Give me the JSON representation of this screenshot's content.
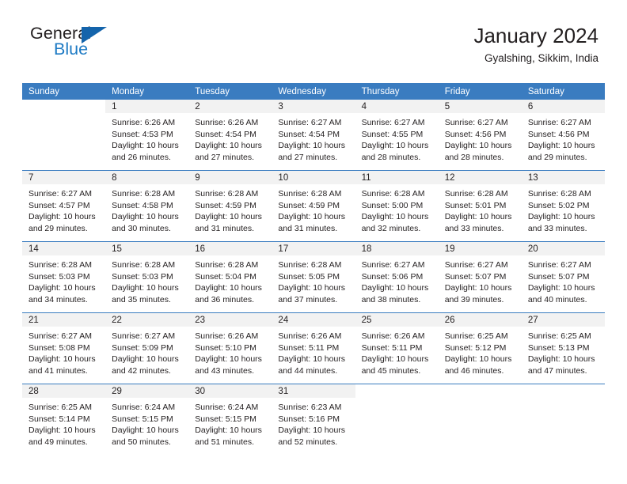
{
  "brand": {
    "name_part1": "General",
    "name_part2": "Blue",
    "logo_icon": "triangle-logo-icon",
    "accent_color": "#1464ab",
    "blue_text_color": "#1d7ac4"
  },
  "header": {
    "title": "January 2024",
    "subtitle": "Gyalshing, Sikkim, India"
  },
  "theme": {
    "header_row_bg": "#3a7cc0",
    "daynum_band_bg": "#f2f2f2",
    "cell_bg": "#ffffff",
    "text_color": "#231f20"
  },
  "calendar": {
    "weekday_headers": [
      "Sunday",
      "Monday",
      "Tuesday",
      "Wednesday",
      "Thursday",
      "Friday",
      "Saturday"
    ],
    "weeks": [
      [
        {
          "day": "",
          "sunrise": "",
          "sunset": "",
          "daylight_line1": "",
          "daylight_line2": "",
          "blank": true
        },
        {
          "day": "1",
          "sunrise": "Sunrise: 6:26 AM",
          "sunset": "Sunset: 4:53 PM",
          "daylight_line1": "Daylight: 10 hours",
          "daylight_line2": "and 26 minutes."
        },
        {
          "day": "2",
          "sunrise": "Sunrise: 6:26 AM",
          "sunset": "Sunset: 4:54 PM",
          "daylight_line1": "Daylight: 10 hours",
          "daylight_line2": "and 27 minutes."
        },
        {
          "day": "3",
          "sunrise": "Sunrise: 6:27 AM",
          "sunset": "Sunset: 4:54 PM",
          "daylight_line1": "Daylight: 10 hours",
          "daylight_line2": "and 27 minutes."
        },
        {
          "day": "4",
          "sunrise": "Sunrise: 6:27 AM",
          "sunset": "Sunset: 4:55 PM",
          "daylight_line1": "Daylight: 10 hours",
          "daylight_line2": "and 28 minutes."
        },
        {
          "day": "5",
          "sunrise": "Sunrise: 6:27 AM",
          "sunset": "Sunset: 4:56 PM",
          "daylight_line1": "Daylight: 10 hours",
          "daylight_line2": "and 28 minutes."
        },
        {
          "day": "6",
          "sunrise": "Sunrise: 6:27 AM",
          "sunset": "Sunset: 4:56 PM",
          "daylight_line1": "Daylight: 10 hours",
          "daylight_line2": "and 29 minutes."
        }
      ],
      [
        {
          "day": "7",
          "sunrise": "Sunrise: 6:27 AM",
          "sunset": "Sunset: 4:57 PM",
          "daylight_line1": "Daylight: 10 hours",
          "daylight_line2": "and 29 minutes."
        },
        {
          "day": "8",
          "sunrise": "Sunrise: 6:28 AM",
          "sunset": "Sunset: 4:58 PM",
          "daylight_line1": "Daylight: 10 hours",
          "daylight_line2": "and 30 minutes."
        },
        {
          "day": "9",
          "sunrise": "Sunrise: 6:28 AM",
          "sunset": "Sunset: 4:59 PM",
          "daylight_line1": "Daylight: 10 hours",
          "daylight_line2": "and 31 minutes."
        },
        {
          "day": "10",
          "sunrise": "Sunrise: 6:28 AM",
          "sunset": "Sunset: 4:59 PM",
          "daylight_line1": "Daylight: 10 hours",
          "daylight_line2": "and 31 minutes."
        },
        {
          "day": "11",
          "sunrise": "Sunrise: 6:28 AM",
          "sunset": "Sunset: 5:00 PM",
          "daylight_line1": "Daylight: 10 hours",
          "daylight_line2": "and 32 minutes."
        },
        {
          "day": "12",
          "sunrise": "Sunrise: 6:28 AM",
          "sunset": "Sunset: 5:01 PM",
          "daylight_line1": "Daylight: 10 hours",
          "daylight_line2": "and 33 minutes."
        },
        {
          "day": "13",
          "sunrise": "Sunrise: 6:28 AM",
          "sunset": "Sunset: 5:02 PM",
          "daylight_line1": "Daylight: 10 hours",
          "daylight_line2": "and 33 minutes."
        }
      ],
      [
        {
          "day": "14",
          "sunrise": "Sunrise: 6:28 AM",
          "sunset": "Sunset: 5:03 PM",
          "daylight_line1": "Daylight: 10 hours",
          "daylight_line2": "and 34 minutes."
        },
        {
          "day": "15",
          "sunrise": "Sunrise: 6:28 AM",
          "sunset": "Sunset: 5:03 PM",
          "daylight_line1": "Daylight: 10 hours",
          "daylight_line2": "and 35 minutes."
        },
        {
          "day": "16",
          "sunrise": "Sunrise: 6:28 AM",
          "sunset": "Sunset: 5:04 PM",
          "daylight_line1": "Daylight: 10 hours",
          "daylight_line2": "and 36 minutes."
        },
        {
          "day": "17",
          "sunrise": "Sunrise: 6:28 AM",
          "sunset": "Sunset: 5:05 PM",
          "daylight_line1": "Daylight: 10 hours",
          "daylight_line2": "and 37 minutes."
        },
        {
          "day": "18",
          "sunrise": "Sunrise: 6:27 AM",
          "sunset": "Sunset: 5:06 PM",
          "daylight_line1": "Daylight: 10 hours",
          "daylight_line2": "and 38 minutes."
        },
        {
          "day": "19",
          "sunrise": "Sunrise: 6:27 AM",
          "sunset": "Sunset: 5:07 PM",
          "daylight_line1": "Daylight: 10 hours",
          "daylight_line2": "and 39 minutes."
        },
        {
          "day": "20",
          "sunrise": "Sunrise: 6:27 AM",
          "sunset": "Sunset: 5:07 PM",
          "daylight_line1": "Daylight: 10 hours",
          "daylight_line2": "and 40 minutes."
        }
      ],
      [
        {
          "day": "21",
          "sunrise": "Sunrise: 6:27 AM",
          "sunset": "Sunset: 5:08 PM",
          "daylight_line1": "Daylight: 10 hours",
          "daylight_line2": "and 41 minutes."
        },
        {
          "day": "22",
          "sunrise": "Sunrise: 6:27 AM",
          "sunset": "Sunset: 5:09 PM",
          "daylight_line1": "Daylight: 10 hours",
          "daylight_line2": "and 42 minutes."
        },
        {
          "day": "23",
          "sunrise": "Sunrise: 6:26 AM",
          "sunset": "Sunset: 5:10 PM",
          "daylight_line1": "Daylight: 10 hours",
          "daylight_line2": "and 43 minutes."
        },
        {
          "day": "24",
          "sunrise": "Sunrise: 6:26 AM",
          "sunset": "Sunset: 5:11 PM",
          "daylight_line1": "Daylight: 10 hours",
          "daylight_line2": "and 44 minutes."
        },
        {
          "day": "25",
          "sunrise": "Sunrise: 6:26 AM",
          "sunset": "Sunset: 5:11 PM",
          "daylight_line1": "Daylight: 10 hours",
          "daylight_line2": "and 45 minutes."
        },
        {
          "day": "26",
          "sunrise": "Sunrise: 6:25 AM",
          "sunset": "Sunset: 5:12 PM",
          "daylight_line1": "Daylight: 10 hours",
          "daylight_line2": "and 46 minutes."
        },
        {
          "day": "27",
          "sunrise": "Sunrise: 6:25 AM",
          "sunset": "Sunset: 5:13 PM",
          "daylight_line1": "Daylight: 10 hours",
          "daylight_line2": "and 47 minutes."
        }
      ],
      [
        {
          "day": "28",
          "sunrise": "Sunrise: 6:25 AM",
          "sunset": "Sunset: 5:14 PM",
          "daylight_line1": "Daylight: 10 hours",
          "daylight_line2": "and 49 minutes."
        },
        {
          "day": "29",
          "sunrise": "Sunrise: 6:24 AM",
          "sunset": "Sunset: 5:15 PM",
          "daylight_line1": "Daylight: 10 hours",
          "daylight_line2": "and 50 minutes."
        },
        {
          "day": "30",
          "sunrise": "Sunrise: 6:24 AM",
          "sunset": "Sunset: 5:15 PM",
          "daylight_line1": "Daylight: 10 hours",
          "daylight_line2": "and 51 minutes."
        },
        {
          "day": "31",
          "sunrise": "Sunrise: 6:23 AM",
          "sunset": "Sunset: 5:16 PM",
          "daylight_line1": "Daylight: 10 hours",
          "daylight_line2": "and 52 minutes."
        },
        {
          "day": "",
          "sunrise": "",
          "sunset": "",
          "daylight_line1": "",
          "daylight_line2": "",
          "blank": true
        },
        {
          "day": "",
          "sunrise": "",
          "sunset": "",
          "daylight_line1": "",
          "daylight_line2": "",
          "blank": true
        },
        {
          "day": "",
          "sunrise": "",
          "sunset": "",
          "daylight_line1": "",
          "daylight_line2": "",
          "blank": true
        }
      ]
    ]
  }
}
